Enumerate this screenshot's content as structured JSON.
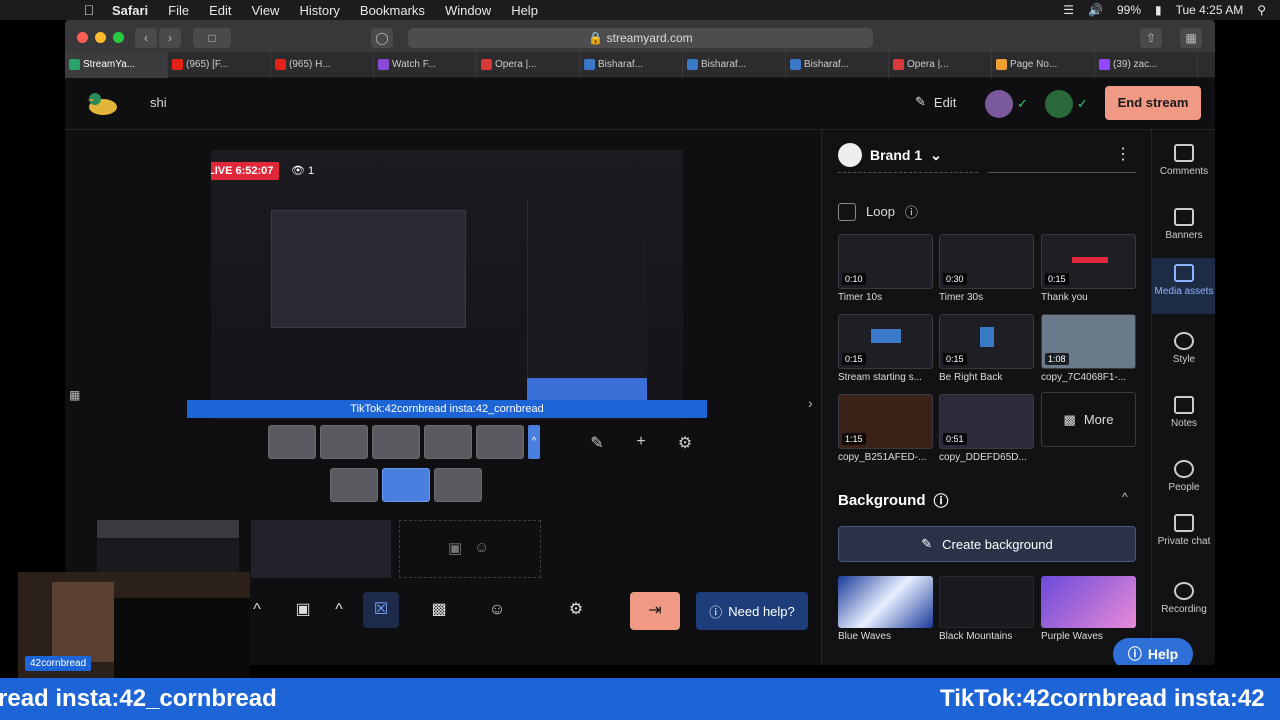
{
  "menubar": {
    "app": "Safari",
    "items": [
      "File",
      "Edit",
      "View",
      "History",
      "Bookmarks",
      "Window",
      "Help"
    ],
    "battery": "99%",
    "clock": "Tue 4:25 AM"
  },
  "browser": {
    "url": "streamyard.com",
    "tabs": [
      {
        "label": "StreamYa..."
      },
      {
        "label": "(965) [F..."
      },
      {
        "label": "(965) H..."
      },
      {
        "label": "Watch F..."
      },
      {
        "label": "Opera |..."
      },
      {
        "label": "Bisharaf..."
      },
      {
        "label": "Bisharaf..."
      },
      {
        "label": "Bisharaf..."
      },
      {
        "label": "Opera |..."
      },
      {
        "label": "Page No..."
      },
      {
        "label": "(39) zac..."
      }
    ]
  },
  "header": {
    "stream_title": "shi",
    "edit_label": "Edit",
    "end_stream_label": "End stream"
  },
  "stage": {
    "live_label": "LIVE 6:52:07",
    "viewer_count": "1",
    "banner_text": "TikTok:42cornbread insta:42_cornbread",
    "need_help_label": "Need help?"
  },
  "panel": {
    "brand": "Brand 1",
    "loop_label": "Loop",
    "media": [
      {
        "caption": "Timer 10s",
        "duration": "0:10"
      },
      {
        "caption": "Timer 30s",
        "duration": "0:30"
      },
      {
        "caption": "Thank you",
        "duration": "0:15"
      },
      {
        "caption": "Stream starting s...",
        "duration": "0:15"
      },
      {
        "caption": "Be Right Back",
        "duration": "0:15"
      },
      {
        "caption": "copy_7C4068F1-...",
        "duration": "1:08"
      },
      {
        "caption": "copy_B251AFED-...",
        "duration": "1:15"
      },
      {
        "caption": "copy_DDEFD65D...",
        "duration": "0:51"
      }
    ],
    "more_label": "More",
    "background_heading": "Background",
    "create_background_label": "Create background",
    "backgrounds": [
      {
        "caption": "Blue Waves",
        "color": "#3a6fd8"
      },
      {
        "caption": "Black Mountains",
        "color": "#1a1a1e"
      },
      {
        "caption": "Purple Waves",
        "color": "#9b6ad8"
      }
    ],
    "help_label": "Help"
  },
  "rail": {
    "items": [
      {
        "label": "Comments"
      },
      {
        "label": "Banners"
      },
      {
        "label": "Media assets"
      },
      {
        "label": "Style"
      },
      {
        "label": "Notes"
      },
      {
        "label": "People"
      },
      {
        "label": "Private chat"
      },
      {
        "label": "Recording"
      }
    ]
  },
  "cam": {
    "name": "42cornbread"
  },
  "ticker": {
    "left_text": "read insta:42_cornbread",
    "right_text": "TikTok:42cornbread insta:42"
  },
  "colors": {
    "accent": "#1d64d6",
    "end_stream": "#f09a86",
    "live": "#e0283a"
  }
}
